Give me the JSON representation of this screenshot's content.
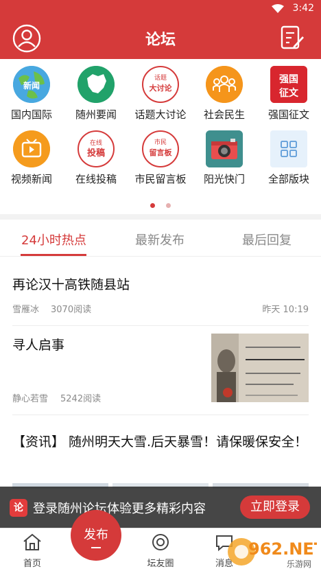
{
  "status": {
    "time": "3:42"
  },
  "header": {
    "title": "论坛"
  },
  "categories": [
    {
      "label": "国内国际",
      "icon": "globe-news-icon",
      "badge": "新闻"
    },
    {
      "label": "随州要闻",
      "icon": "map-region-icon",
      "badge": ""
    },
    {
      "label": "话题大讨论",
      "icon": "topic-stamp-icon",
      "badge": "话题 大讨论"
    },
    {
      "label": "社会民生",
      "icon": "people-icon",
      "badge": ""
    },
    {
      "label": "强国征文",
      "icon": "essay-icon",
      "badge": "强国 征文"
    },
    {
      "label": "视频新闻",
      "icon": "tv-icon",
      "badge": ""
    },
    {
      "label": "在线投稿",
      "icon": "submit-stamp-icon",
      "badge": "在线 投稿"
    },
    {
      "label": "市民留言板",
      "icon": "message-stamp-icon",
      "badge": "市民 留言板"
    },
    {
      "label": "阳光快门",
      "icon": "camera-icon",
      "badge": ""
    },
    {
      "label": "全部版块",
      "icon": "grid-icon",
      "badge": ""
    }
  ],
  "tabs": [
    "24小时热点",
    "最新发布",
    "最后回复"
  ],
  "posts": [
    {
      "title": "再论汉十高铁随县站",
      "author": "雪雁冰",
      "reads": "3070阅读",
      "time": "昨天 10:19"
    },
    {
      "title": "寻人启事",
      "author": "静心若雪",
      "reads": "5242阅读",
      "time": ""
    },
    {
      "title": "【资讯】 随州明天大雪.后天暴雪！请保暖保安全！",
      "author": "",
      "reads": "",
      "time": ""
    }
  ],
  "banner": {
    "badge": "论",
    "text": "登录随州论坛体验更多精彩内容",
    "button": "立即登录"
  },
  "nav": {
    "home": "首页",
    "publish": "发布",
    "circle": "坛友圈",
    "messages": "消息"
  },
  "watermark": {
    "text": "962.NET",
    "sub": "乐游网"
  },
  "colors": {
    "accent": "#d53a3a",
    "tab_inactive": "#888888",
    "meta": "#8a8a8a"
  }
}
